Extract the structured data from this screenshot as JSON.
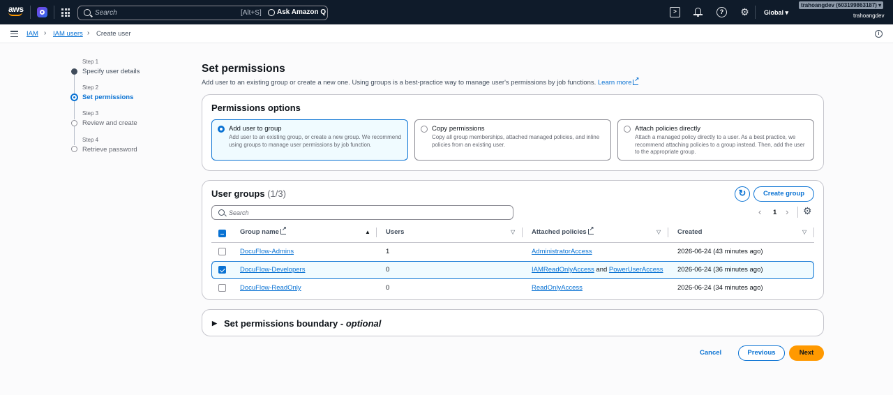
{
  "topbar": {
    "search_placeholder": "Search",
    "search_shortcut": "[Alt+S]",
    "ask_q_label": "Ask Amazon Q",
    "region": "Global",
    "account_chip": "trahoangdev (603199863187) ▾",
    "account_user": "trahoangdev",
    "icons": [
      "aws-logo",
      "amazon-q-icon",
      "services-grid-icon",
      "cloudshell-icon",
      "bell-icon",
      "help-icon",
      "gear-icon"
    ]
  },
  "breadcrumb": {
    "items": [
      {
        "label": "IAM",
        "link": true
      },
      {
        "label": "IAM users",
        "link": true
      },
      {
        "label": "Create user",
        "link": false
      }
    ],
    "separator": ">"
  },
  "wizard": {
    "steps": [
      {
        "num": "Step 1",
        "title": "Specify user details",
        "state": "done"
      },
      {
        "num": "Step 2",
        "title": "Set permissions",
        "state": "active"
      },
      {
        "num": "Step 3",
        "title": "Review and create",
        "state": "todo"
      },
      {
        "num": "Step 4",
        "title": "Retrieve password",
        "state": "todo"
      }
    ]
  },
  "page": {
    "title": "Set permissions",
    "description": "Add user to an existing group or create a new one. Using groups is a best-practice way to manage user's permissions by job functions.",
    "learn_more": "Learn more"
  },
  "permissions_options": {
    "title": "Permissions options",
    "options": [
      {
        "title": "Add user to group",
        "desc": "Add user to an existing group, or create a new group. We recommend using groups to manage user permissions by job function.",
        "selected": true
      },
      {
        "title": "Copy permissions",
        "desc": "Copy all group memberships, attached managed policies, and inline policies from an existing user.",
        "selected": false
      },
      {
        "title": "Attach policies directly",
        "desc": "Attach a managed policy directly to a user. As a best practice, we recommend attaching policies to a group instead. Then, add the user to the appropriate group.",
        "selected": false
      }
    ]
  },
  "user_groups": {
    "title": "User groups",
    "count": "(1/3)",
    "refresh_icon": "↻",
    "create_label": "Create group",
    "search_placeholder": "Search",
    "page": "1",
    "prev_icon": "‹",
    "next_icon": "›",
    "settings_icon": "⚙",
    "columns": [
      "Group name",
      "Users",
      "Attached policies",
      "Created"
    ],
    "rows": [
      {
        "name": "DocuFlow-Admins",
        "users": "1",
        "policies": [
          "AdministratorAccess"
        ],
        "created": "2026-06-24 (43 minutes ago)",
        "checked": false
      },
      {
        "name": "DocuFlow-Developers",
        "users": "0",
        "policies": [
          "IAMReadOnlyAccess",
          "PowerUserAccess"
        ],
        "policy_joiner": "and",
        "created": "2026-06-24 (36 minutes ago)",
        "checked": true
      },
      {
        "name": "DocuFlow-ReadOnly",
        "users": "0",
        "policies": [
          "ReadOnlyAccess"
        ],
        "created": "2026-06-24 (34 minutes ago)",
        "checked": false
      }
    ]
  },
  "boundary": {
    "title": "Set permissions boundary - ",
    "optional": "optional"
  },
  "footer": {
    "cancel": "Cancel",
    "previous": "Previous",
    "next": "Next"
  },
  "colors": {
    "topbar_bg": "#0f1b2a",
    "link": "#0972d3",
    "primary_button": "#ff9900",
    "selected_bg": "#f0fbff"
  }
}
